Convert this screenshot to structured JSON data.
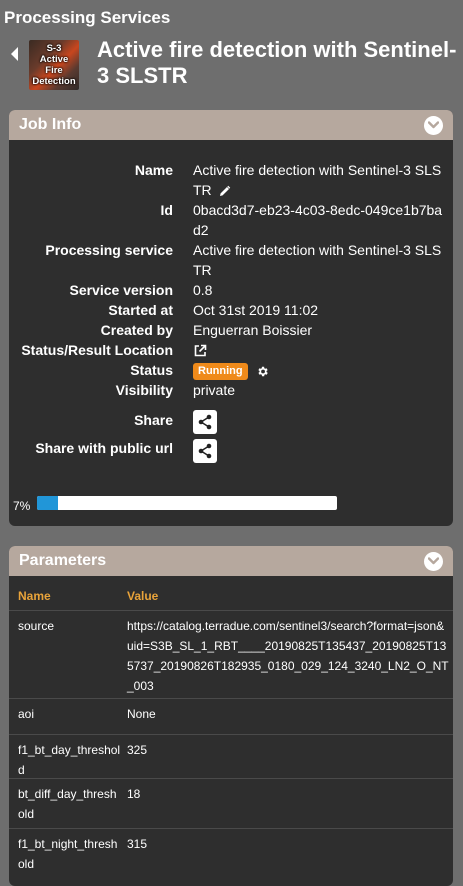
{
  "app": {
    "title": "Processing Services"
  },
  "header": {
    "thumbnail_lines": [
      "S-3",
      "Active",
      "Fire",
      "Detection"
    ],
    "title": "Active fire detection with Sentinel-3 SLSTR"
  },
  "job_info": {
    "title": "Job Info",
    "fields": {
      "name": {
        "label": "Name",
        "value": "Active fire detection with Sentinel-3 SLSTR"
      },
      "id": {
        "label": "Id",
        "value": "0bacd3d7-eb23-4c03-8edc-049ce1b7bad2"
      },
      "processing_service": {
        "label": "Processing service",
        "value": "Active fire detection with Sentinel-3 SLSTR"
      },
      "service_version": {
        "label": "Service version",
        "value": "0.8"
      },
      "started_at": {
        "label": "Started at",
        "value": "Oct 31st 2019 11:02"
      },
      "created_by": {
        "label": "Created by",
        "value": "Enguerran Boissier"
      },
      "status_location": {
        "label": "Status/Result Location"
      },
      "status": {
        "label": "Status",
        "value": "Running"
      },
      "visibility": {
        "label": "Visibility",
        "value": "private"
      },
      "share": {
        "label": "Share"
      },
      "share_public": {
        "label": "Share with public url"
      }
    },
    "progress": {
      "label": "7%",
      "percent": 7
    }
  },
  "parameters": {
    "title": "Parameters",
    "columns": {
      "name": "Name",
      "value": "Value"
    },
    "rows": [
      {
        "name": "source",
        "value": "https://catalog.terradue.com/sentinel3/search?format=json&uid=S3B_SL_1_RBT____20190825T135437_20190825T135737_20190826T182935_0180_029_124_3240_LN2_O_NT_003"
      },
      {
        "name": "aoi",
        "value": "None"
      },
      {
        "name": "f1_bt_day_threshold",
        "value": "325"
      },
      {
        "name": "bt_diff_day_threshold",
        "value": "18"
      },
      {
        "name": "f1_bt_night_threshold",
        "value": "315"
      }
    ]
  },
  "colors": {
    "background": "#6e6e6e",
    "panel": "#2e2e2e",
    "panel_header": "#b6a89e",
    "accent_status": "#ef8a1a",
    "progress": "#2196d8",
    "table_header": "#e8a33a"
  },
  "icons": [
    "back-icon",
    "chevron-down-icon",
    "edit-icon",
    "external-link-icon",
    "gear-icon",
    "share-icon"
  ]
}
